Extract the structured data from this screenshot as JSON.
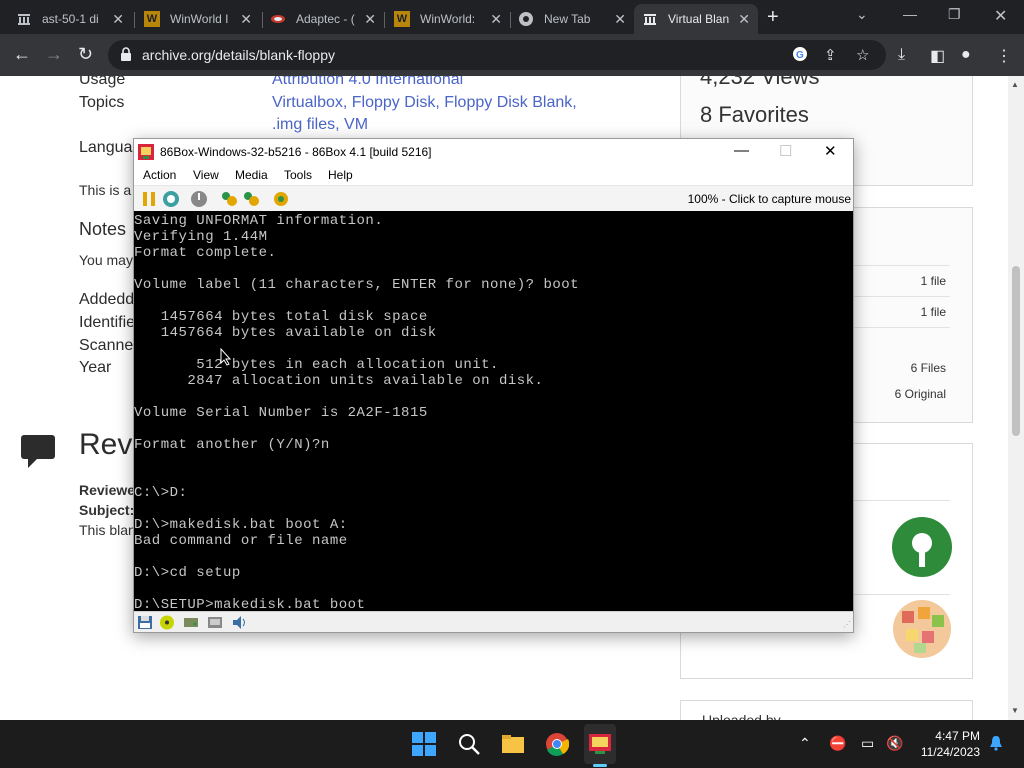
{
  "browser": {
    "tabs": [
      {
        "title": "ast-50-1 di",
        "icon": "archive-icon"
      },
      {
        "title": "WinWorld I",
        "icon": "winworld-icon"
      },
      {
        "title": "Adaptec - (",
        "icon": "adaptec-icon"
      },
      {
        "title": "WinWorld:",
        "icon": "winworld-icon"
      },
      {
        "title": "New Tab",
        "icon": "chrome-icon"
      },
      {
        "title": "Virtual Blan",
        "icon": "archive-icon"
      }
    ],
    "url": "archive.org/details/blank-floppy"
  },
  "page": {
    "meta": [
      {
        "label": "Usage",
        "value": "Attribution 4.0 International"
      },
      {
        "label": "Topics",
        "value": "Virtualbox, Floppy Disk, Floppy Disk Blank,"
      },
      {
        "label": "",
        "value": ".img files, VM"
      },
      {
        "label": "Langua",
        "value": ""
      },
      {
        "label": "This is a",
        "value": ""
      }
    ],
    "notes_heading": "Notes",
    "notes_text": "You may",
    "details": [
      "Addedd",
      "Identifie",
      "Scanne",
      "Year"
    ],
    "reviews_heading": "Rev",
    "reviewer_label": "Reviewe",
    "subject_label": "Subject:",
    "review_text": "This blan",
    "views": "4,232 Views",
    "favorites": "8 Favorites",
    "side_rows": [
      "1 file",
      "1 file",
      "6 Files",
      "6 Original"
    ],
    "uploaded_by": "Uploaded by"
  },
  "vm": {
    "title": "86Box-Windows-32-b5216 - 86Box 4.1 [build 5216]",
    "menu": [
      "Action",
      "View",
      "Media",
      "Tools",
      "Help"
    ],
    "status": "100% - Click to capture mouse",
    "screen_lines": [
      "Saving UNFORMAT information.",
      "Verifying 1.44M",
      "Format complete.",
      "",
      "Volume label (11 characters, ENTER for none)? boot",
      "",
      "   1457664 bytes total disk space",
      "   1457664 bytes available on disk",
      "",
      "       512 bytes in each allocation unit.",
      "      2847 allocation units available on disk.",
      "",
      "Volume Serial Number is 2A2F-1815",
      "",
      "Format another (Y/N)?n",
      "",
      "",
      "C:\\>D:",
      "",
      "D:\\>makedisk.bat boot A:",
      "Bad command or file name",
      "",
      "D:\\>cd setup",
      "",
      "D:\\SETUP>makedisk.bat boot"
    ]
  },
  "taskbar": {
    "time": "4:47 PM",
    "date": "11/24/2023"
  }
}
